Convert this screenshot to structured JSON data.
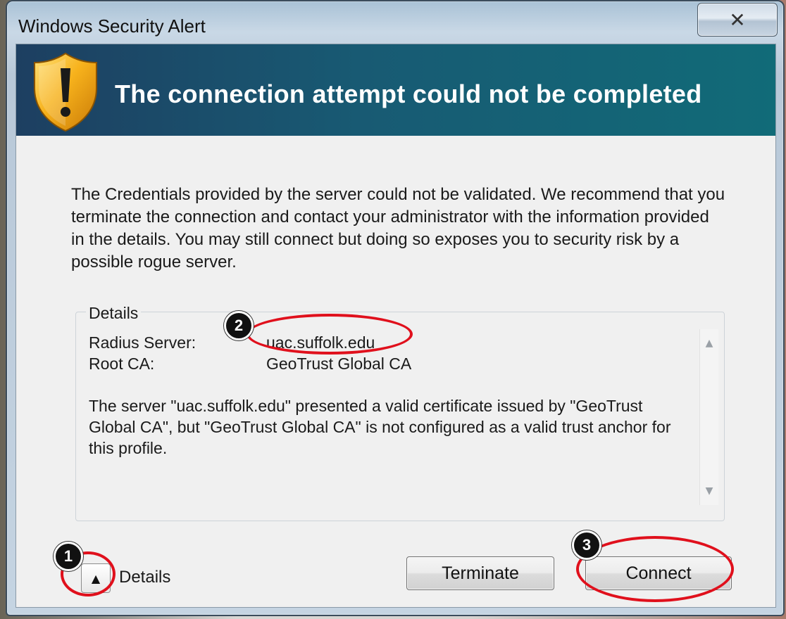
{
  "window": {
    "title": "Windows Security Alert",
    "close_glyph": "✕"
  },
  "banner": {
    "title": "The connection attempt could not be completed",
    "icon": "shield-warning-icon"
  },
  "message": "The Credentials provided by the server could not be validated. We recommend that you terminate the connection and contact your administrator with the information provided in the details. You may still connect but doing so exposes you to security risk by a possible rogue server.",
  "details": {
    "legend": "Details",
    "radius_label": "Radius Server:",
    "radius_value": "uac.suffolk.edu",
    "root_label": "Root CA:",
    "root_value": "GeoTrust Global CA",
    "description": "The server \"uac.suffolk.edu\" presented a valid certificate issued by \"GeoTrust Global CA\", but \"GeoTrust Global CA\" is not configured as a valid trust anchor for this profile."
  },
  "footer": {
    "toggle_glyph": "▲",
    "toggle_label": "Details",
    "terminate_label": "Terminate",
    "connect_label": "Connect"
  },
  "annotations": {
    "step1": "1",
    "step2": "2",
    "step3": "3"
  },
  "colors": {
    "annotation_red": "#e0101c",
    "banner_start": "#1d3f61",
    "banner_end": "#116b78"
  }
}
